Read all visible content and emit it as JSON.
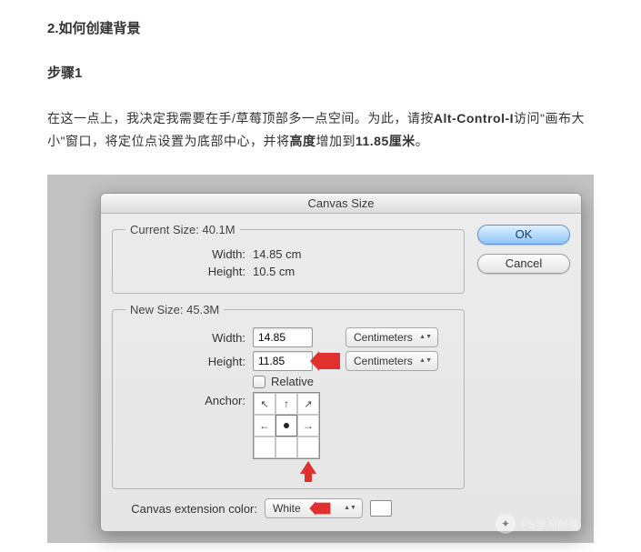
{
  "article": {
    "heading": "2.如何创建背景",
    "step_label": "步骤1",
    "para_parts": {
      "p1": "在这一点上，我决定我需要在手/草莓顶部多一点空间。为此，请按",
      "kbd": "Alt-Control-I",
      "p2": "访问\"画布大小\"窗口，将定位点设置为底部中心，并将",
      "bold1": "高度",
      "p3": "增加到",
      "bold2": "11.85厘米",
      "p4": "。"
    }
  },
  "dialog": {
    "title": "Canvas Size",
    "current": {
      "legend": "Current Size: 40.1M",
      "width_label": "Width:",
      "width_value": "14.85 cm",
      "height_label": "Height:",
      "height_value": "10.5 cm"
    },
    "new": {
      "legend": "New Size: 45.3M",
      "width_label": "Width:",
      "width_value": "14.85",
      "width_unit": "Centimeters",
      "height_label": "Height:",
      "height_value": "11.85",
      "height_unit": "Centimeters",
      "relative_label": "Relative",
      "anchor_label": "Anchor:"
    },
    "extension": {
      "label": "Canvas extension color:",
      "value": "White"
    },
    "buttons": {
      "ok": "OK",
      "cancel": "Cancel"
    }
  },
  "watermark": {
    "text": "PS学习部落"
  }
}
